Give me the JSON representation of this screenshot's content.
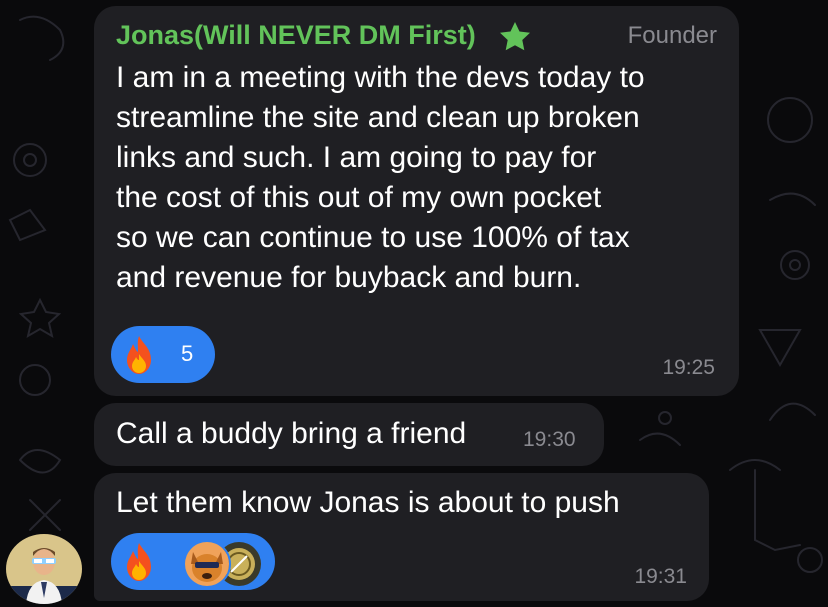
{
  "chat": {
    "sender": {
      "name": "Jonas(Will NEVER DM First)",
      "role": "Founder",
      "badge_icon": "star-icon",
      "name_color": "#62c35a"
    },
    "messages": [
      {
        "text": "I am in a meeting with the devs today to\nstreamline the site and clean up broken\nlinks and such.  I am going to pay for\nthe cost of this out of my own pocket\nso we can continue to use 100% of tax\nand revenue for buyback and burn.",
        "time": "19:25",
        "reaction": {
          "emoji_icon": "fire-icon",
          "count": "5"
        }
      },
      {
        "text": "Call a buddy bring a friend",
        "time": "19:30"
      },
      {
        "text": "Let them know Jonas is about to push",
        "time": "19:31",
        "reaction": {
          "emoji_icon": "fire-icon",
          "reactor_avatars": [
            "dog-avatar-icon",
            "coin-avatar-icon"
          ]
        }
      }
    ],
    "colors": {
      "bubble": "#1f1f23",
      "reaction": "#2f80f1",
      "muted": "#8a8a90"
    }
  }
}
